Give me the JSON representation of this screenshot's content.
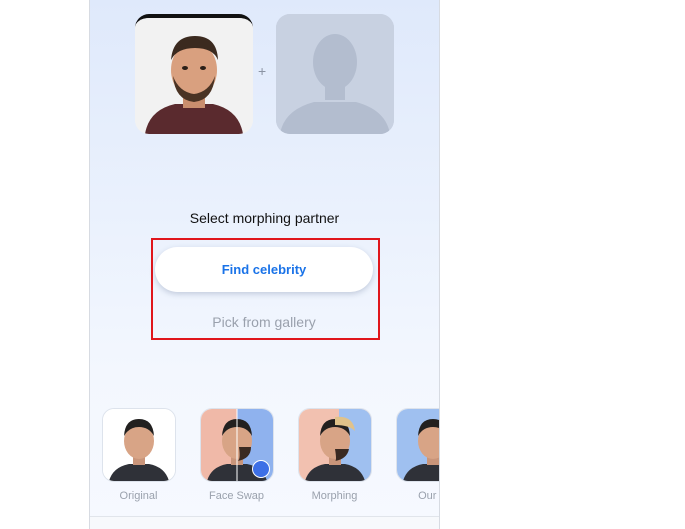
{
  "morph": {
    "plus_sign": "+",
    "prompt": "Select morphing partner",
    "find_celebrity": "Find celebrity",
    "pick_gallery": "Pick from gallery"
  },
  "modes": [
    {
      "label": "Original"
    },
    {
      "label": "Face Swap"
    },
    {
      "label": "Morphing"
    },
    {
      "label": "Our S"
    }
  ],
  "colors": {
    "accent": "#1a73e8",
    "highlight": "#e0161c"
  }
}
